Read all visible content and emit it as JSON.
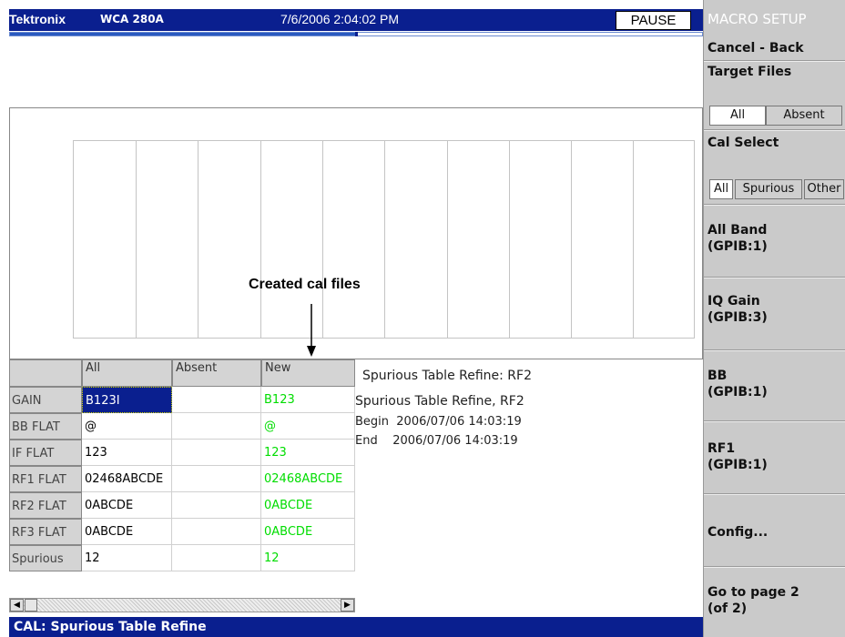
{
  "header": {
    "brand": "Tektronix",
    "model": "WCA 280A",
    "datetime": "7/6/2006 2:04:02 PM",
    "pause_label": "PAUSE"
  },
  "callout": "Created cal files",
  "table": {
    "columns": [
      "All",
      "Absent",
      "New"
    ],
    "rows": [
      {
        "label": "GAIN",
        "all": "B123I",
        "absent": "",
        "new": "B123"
      },
      {
        "label": "BB FLAT",
        "all": "@",
        "absent": "",
        "new": "@"
      },
      {
        "label": "IF FLAT",
        "all": "123",
        "absent": "",
        "new": "123"
      },
      {
        "label": "RF1 FLAT",
        "all": "02468ABCDE",
        "absent": "",
        "new": "02468ABCDE"
      },
      {
        "label": "RF2 FLAT",
        "all": "0ABCDE",
        "absent": "",
        "new": "0ABCDE"
      },
      {
        "label": "RF3 FLAT",
        "all": "0ABCDE",
        "absent": "",
        "new": "0ABCDE"
      },
      {
        "label": "Spurious",
        "all": "12",
        "absent": "",
        "new": "12"
      }
    ]
  },
  "log": {
    "title": "Spurious Table Refine: RF2",
    "line1": "Spurious Table Refine, RF2",
    "line2": "Begin  2006/07/06 14:03:19",
    "line3": "End    2006/07/06 14:03:19"
  },
  "status": "CAL: Spurious Table Refine",
  "menu": {
    "title": "MACRO SETUP",
    "cancel": "Cancel - Back",
    "target_files": {
      "label": "Target Files",
      "options": [
        "All",
        "Absent"
      ],
      "selected": "All"
    },
    "cal_select": {
      "label": "Cal Select",
      "options": [
        "All",
        "Spurious",
        "Other"
      ],
      "selected": "All"
    },
    "all_band": {
      "line1": "All Band",
      "line2": "(GPIB:1)"
    },
    "iq_gain": {
      "line1": "IQ Gain",
      "line2": "(GPIB:3)"
    },
    "bb": {
      "line1": "BB",
      "line2": "(GPIB:1)"
    },
    "rf1": {
      "line1": "RF1",
      "line2": "(GPIB:1)"
    },
    "config": "Config...",
    "go_page": {
      "line1": "Go to page 2",
      "line2": "(of 2)"
    }
  },
  "colors": {
    "title_bar": "#0a1f8f",
    "new_text": "#00dd00",
    "menu_bg": "#cacaca"
  }
}
